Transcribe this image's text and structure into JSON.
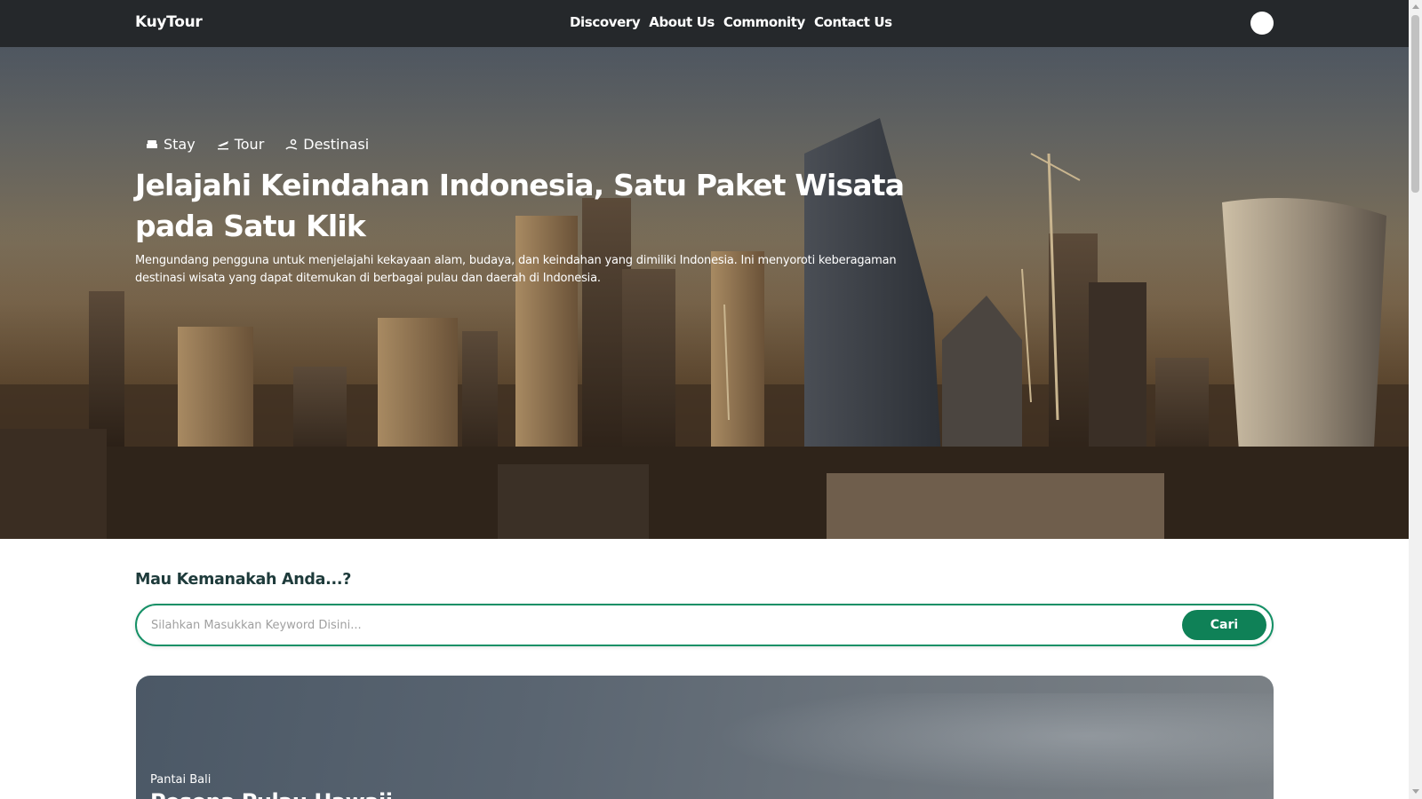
{
  "navbar": {
    "brand": "KuyTour",
    "links": [
      "Discovery",
      "About Us",
      "Commonity",
      "Contact Us"
    ],
    "avatar_icon": "user-avatar-icon"
  },
  "hero": {
    "tabs": [
      {
        "label": "Stay",
        "icon": "bed-icon"
      },
      {
        "label": "Tour",
        "icon": "plane-icon"
      },
      {
        "label": "Destinasi",
        "icon": "map-pin-icon"
      }
    ],
    "title": "Jelajahi Keindahan Indonesia, Satu Paket Wisata pada Satu Klik",
    "description": "Mengundang pengguna untuk menjelajahi kekayaan alam, budaya, dan keindahan yang dimiliki Indonesia. Ini menyoroti keberagaman destinasi wisata yang dapat ditemukan di berbagai pulau dan daerah di Indonesia."
  },
  "search": {
    "heading": "Mau Kemanakah Anda...?",
    "placeholder": "Silahkan Masukkan Keyword Disini...",
    "value": "",
    "button_label": "Cari"
  },
  "card": {
    "subtitle": "Pantai Bali",
    "title": "Pesona Pulau Hawaii"
  },
  "colors": {
    "navbar": "#25282b",
    "accent": "#0f8157",
    "heading": "#1e3b3b"
  }
}
